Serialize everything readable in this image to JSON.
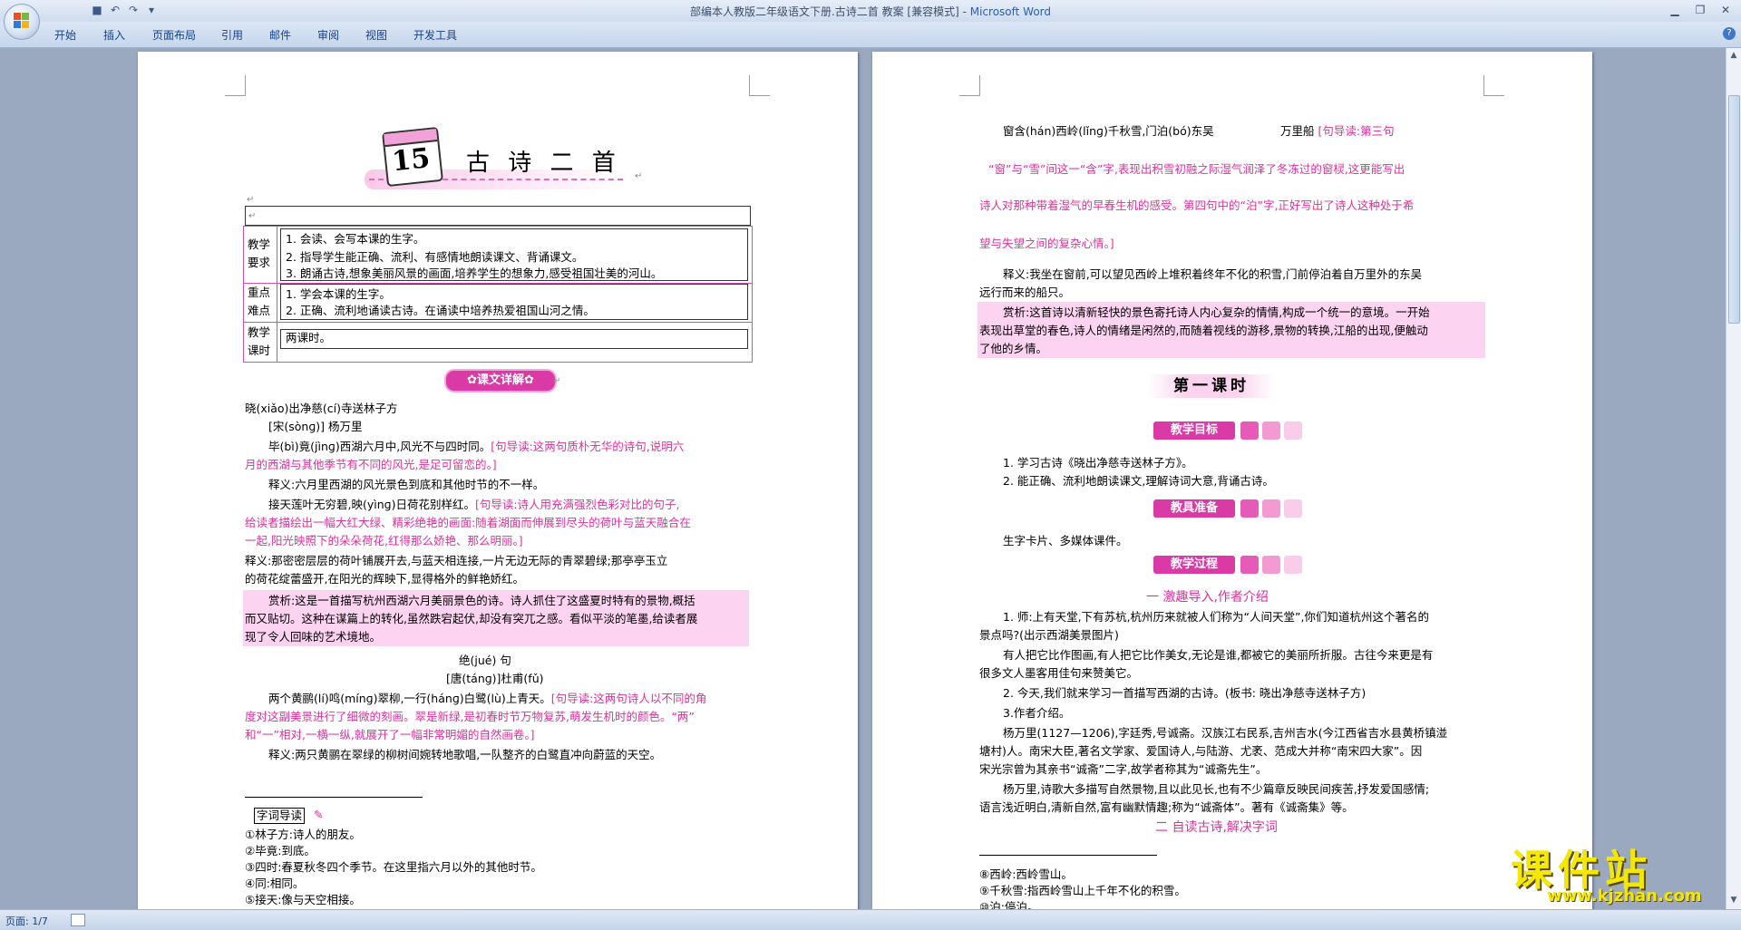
{
  "window": {
    "title": "部编本人教版二年级语文下册.古诗二首 教案 [兼容模式] - ",
    "app": "Microsoft Word"
  },
  "ribbon_tabs": [
    "开始",
    "插入",
    "页面布局",
    "引用",
    "邮件",
    "审阅",
    "视图",
    "开发工具"
  ],
  "status": {
    "page": "页面: 1/7"
  },
  "watermark": {
    "text": "课件站",
    "url": "www.kjzhan.com"
  },
  "left_page": {
    "lesson_num": "15",
    "lesson_title": "古 诗 二 首",
    "table": [
      {
        "label": "教学\n要求",
        "lines": [
          "1. 会读、会写本课的生字。",
          "2. 指导学生能正确、流利、有感情地朗读课文、背诵课文。",
          "3. 朗诵古诗,想象美丽风景的画面,培养学生的想象力,感受祖国壮美的河山。"
        ]
      },
      {
        "label": "重点\n难点",
        "lines": [
          "1.  学会本课的生字。",
          "2. 正确、流利地诵读古诗。在诵读中培养热爱祖国山河之情。"
        ]
      },
      {
        "label": "教学\n课时",
        "lines": [
          "     两课时。"
        ]
      }
    ],
    "section_banner": "✿课文详解✿",
    "poem1_title": "晓(xiǎo)出净慈(cí)寺送林子方",
    "poem1_author": "[宋(sònɡ)] 杨万里",
    "lines": [
      {
        "t": "毕(bì)竟(jìnɡ)西湖六月中,风光不与四时同。",
        "p": "[句导读:这两句质朴无华的诗句,说明六"
      },
      {
        "t": "",
        "p": "月的西湖与其他季节有不同的风光,是足可留恋的。]"
      },
      {
        "t": "释义:六月里西湖的风光景色到底和其他时节的不一样。",
        "p": ""
      },
      {
        "t": "接天莲叶无穷碧,映(yìnɡ)日荷花别样红。",
        "p": "[句导读:诗人用充满强烈色彩对比的句子,"
      },
      {
        "t": "",
        "p": "给读者描绘出一幅大红大绿、精彩绝艳的画面:随着湖面而伸展到尽头的荷叶与蓝天融合在"
      },
      {
        "t": "",
        "p": "一起,阳光映照下的朵朵荷花,红得那么娇艳、那么明丽。]"
      },
      {
        "t": "释义:那密密层层的荷叶铺展开去,与蓝天相连接,一片无边无际的青翠碧绿;那亭亭玉立",
        "p": ""
      },
      {
        "t": "的荷花绽蕾盛开,在阳光的辉映下,显得格外的鲜艳娇红。",
        "p": ""
      }
    ],
    "appreciation": [
      "赏析:这是一首描写杭州西湖六月美丽景色的诗。诗人抓住了这盛夏时特有的景物,概括",
      "而又贴切。这种在谋篇上的转化,虽然跌宕起伏,却没有突兀之感。看似平淡的笔墨,给读者展",
      "现了令人回味的艺术境地。"
    ],
    "poem2_title": "绝(jué)      句",
    "poem2_author": "[唐(tánɡ)]杜甫(fǔ)",
    "poem2_lines": [
      {
        "t": "两个黄鹂(lí)鸣(mínɡ)翠柳,一行(hánɡ)白鹭(lù)上青天。",
        "p": "[句导读:这两句诗人以不同的角"
      },
      {
        "t": "",
        "p": "度对这副美景进行了细微的刻画。翠是新绿,是初春时节万物复苏,萌发生机时的颜色。“两”"
      },
      {
        "t": "",
        "p": "和“一”相对,一横一纵,就展开了一幅非常明媚的自然画卷。]"
      },
      {
        "t": "释义:两只黄鹂在翠绿的柳树间婉转地歌唱,一队整齐的白鹭直冲向蔚蓝的天空。",
        "p": ""
      }
    ],
    "footnote_heading": "字词导读",
    "footnotes": [
      "①林子方:诗人的朋友。",
      "②毕竟:到底。",
      "③四时:春夏秋冬四个季节。在这里指六月以外的其他时节。",
      "④同:相同。",
      "⑤接天:像与天空相接。"
    ]
  },
  "right_page": {
    "top_lines": [
      {
        "t": "窗含(hán)西岭(lǐnɡ)千秋雪,门泊(bó)东吴",
        "p": ""
      },
      {
        "t": "万里船",
        "p": "[句导读:第三句"
      }
    ],
    "pink_lines": [
      "“窗”与“雪”间这一“含”字,表现出积雪初融之际湿气润泽了冬冻过的窗棂,这更能写出",
      "诗人对那种带着湿气的早春生机的感受。第四句中的“泊”字,正好写出了诗人这种处于希",
      "望与失望之间的复杂心情。]"
    ],
    "shiyi": [
      "释义:我坐在窗前,可以望见西岭上堆积着终年不化的积雪,门前停泊着自万里外的东吴",
      "远行而来的船只。"
    ],
    "shangxi": [
      "赏析:这首诗以清新轻快的景色寄托诗人内心复杂的情情,构成一个统一的意境。一开始",
      "表现出草堂的春色,诗人的情绪是闲然的,而随着视线的游移,景物的转换,江船的出现,便触动",
      "了他的乡情。"
    ],
    "lesson_title": "第一课时",
    "goal_banner": "教学目标",
    "goals": [
      "1.  学习古诗《晓出净慈寺送林子方》。",
      "2. 能正确、流利地朗读课文,理解诗词大意,背诵古诗。"
    ],
    "prep_banner": "教具准备",
    "prep": "生字卡片、多媒体课件。",
    "process_banner": "教学过程",
    "step1": "一   激趣导入,作者介绍",
    "body": [
      "1. 师:上有天堂,下有苏杭,杭州历来就被人们称为“人间天堂”,你们知道杭州这个著名的",
      "景点吗?(出示西湖美景图片)",
      "有人把它比作图画,有人把它比作美女,无论是谁,都被它的美丽所折服。古往今来更是有",
      "很多文人墨客用佳句来赞美它。",
      "2. 今天,我们就来学习一首描写西湖的古诗。(板书: 晓出净慈寺送林子方)",
      "3.作者介绍。",
      "杨万里(1127—1206),字廷秀,号诚斋。汉族江右民系,吉州吉水(今江西省吉水县黄桥镇湴",
      "塘村)人。南宋大臣,著名文学家、爱国诗人,与陆游、尤袤、范成大并称“南宋四大家”。因",
      "宋光宗曾为其亲书“诚斋”二字,故学者称其为“诚斋先生”。",
      "杨万里,诗歌大多描写自然景物,且以此见长,也有不少篇章反映民间疾苦,抒发爱国感情;",
      "语言浅近明白,清新自然,富有幽默情趣;称为“诚斋体”。著有《诚斋集》等。"
    ],
    "step2": "二   自读古诗,解决字词",
    "footnotes": [
      "⑧西岭:西岭雪山。",
      "⑨千秋雪:指西岭雪山上千年不化的积雪。",
      "⑩泊:停泊。"
    ]
  }
}
